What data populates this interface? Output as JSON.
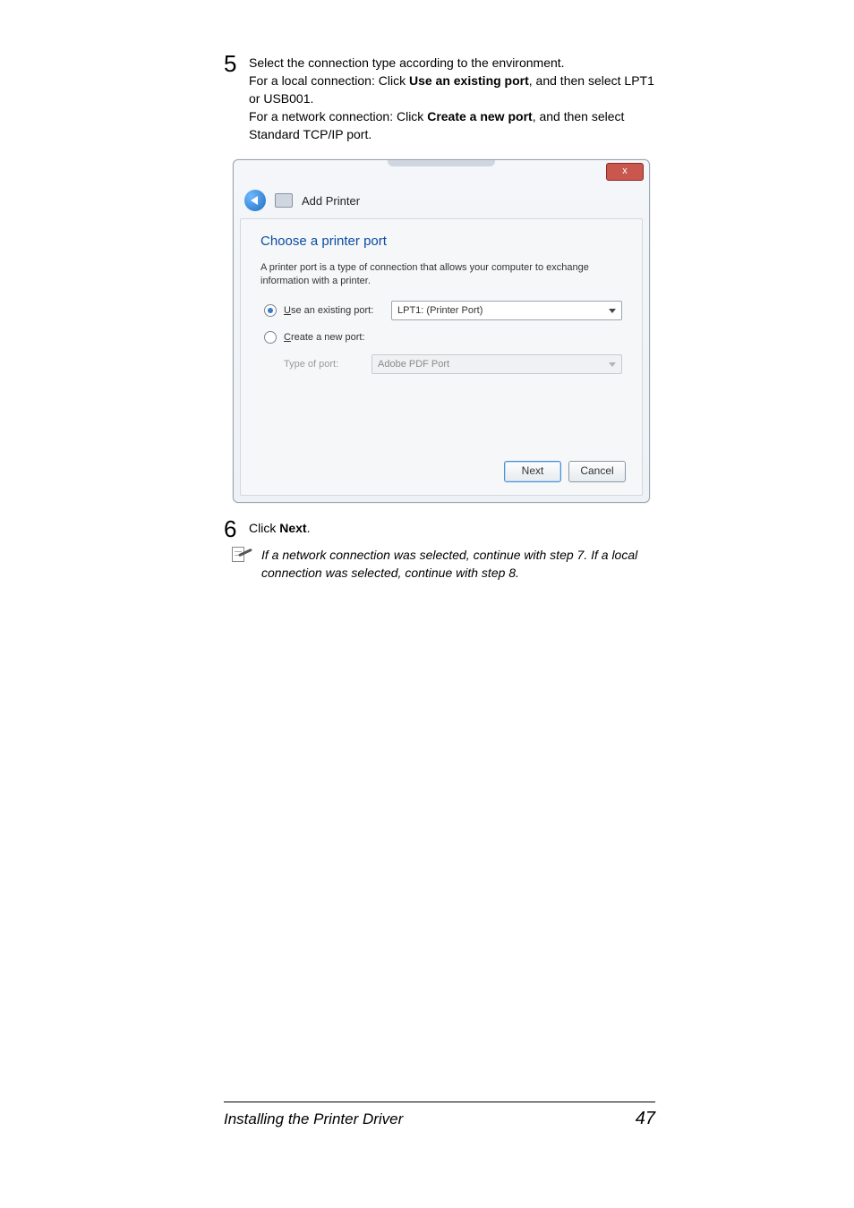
{
  "step5": {
    "number": "5",
    "line1": "Select the connection type according to the environment.",
    "line2a": "For a local connection: Click ",
    "line2b": "Use an existing port",
    "line2c": ", and then select LPT1 or USB001.",
    "line3a": "For a network connection: Click ",
    "line3b": "Create a new port",
    "line3c": ", and then select Standard TCP/IP port."
  },
  "dialog": {
    "close_label": "x",
    "title": "Add Printer",
    "heading": "Choose a printer port",
    "desc": "A printer port is a type of connection that allows your computer to exchange information with a printer.",
    "use_existing_u": "U",
    "use_existing_rest": "se an existing port:",
    "existing_value": "LPT1: (Printer Port)",
    "create_new_u": "C",
    "create_new_rest": "reate a new port:",
    "type_of_port": "Type of port:",
    "new_value": "Adobe PDF Port",
    "next": "Next",
    "cancel": "Cancel"
  },
  "step6": {
    "number": "6",
    "text_a": "Click ",
    "text_b": "Next",
    "text_c": "."
  },
  "note": {
    "text": "If a network connection was selected, continue with step 7. If a local connection was selected, continue with step 8."
  },
  "footer": {
    "left": "Installing the Printer Driver",
    "right": "47"
  }
}
